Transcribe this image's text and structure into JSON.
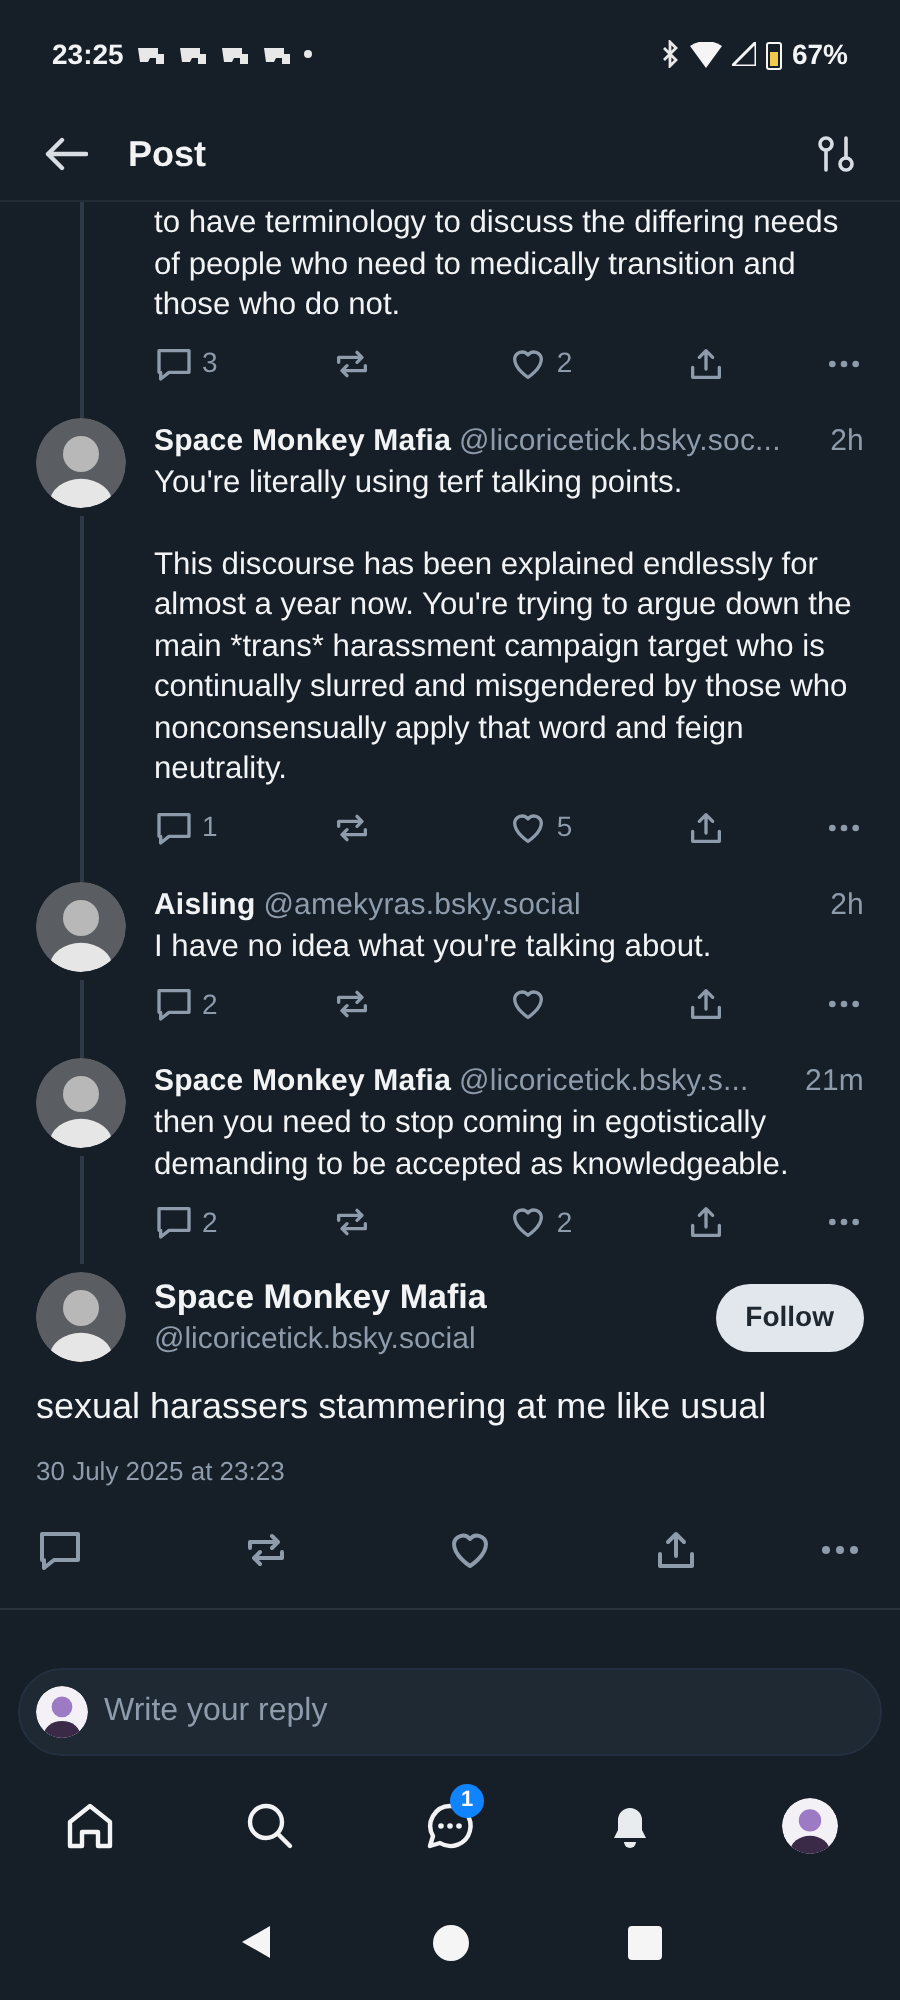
{
  "status_bar": {
    "time": "23:25",
    "battery": "67%"
  },
  "header": {
    "title": "Post"
  },
  "replies": [
    {
      "kind": "partial",
      "text": "to have terminology to discuss the differing needs of people who need to medically transition and those who do not.",
      "reply_count": "3",
      "like_count": "2"
    },
    {
      "kind": "full",
      "name": "Space Monkey Mafia",
      "handle": "@licoricetick.bsky.soc...",
      "time": "2h",
      "text": "You're literally using terf talking points.\n\nThis discourse has been explained endlessly for almost a year now. You're trying to argue down the main *trans* harassment campaign target who is continually slurred and misgendered by those who nonconsensually apply that word and feign neutrality.",
      "reply_count": "1",
      "like_count": "5"
    },
    {
      "kind": "full",
      "name": "Aisling",
      "handle": "@amekyras.bsky.social",
      "time": "2h",
      "text": "I have no idea what you're talking about.",
      "reply_count": "2"
    },
    {
      "kind": "full",
      "name": "Space Monkey Mafia",
      "handle": "@licoricetick.bsky.s...",
      "time": "21m",
      "text": "then you need to stop coming in egotistically demanding to be accepted as knowledgeable.",
      "reply_count": "2",
      "like_count": "2"
    }
  ],
  "main_post": {
    "name": "Space Monkey Mafia",
    "handle": "@licoricetick.bsky.social",
    "follow_label": "Follow",
    "text": "sexual harassers stammering at me like usual",
    "date": "30 July 2025 at 23:23"
  },
  "reply_field": {
    "placeholder": "Write your reply"
  },
  "nav": [
    {
      "kind": "home"
    },
    {
      "kind": "search"
    },
    {
      "kind": "chat",
      "badge": "1"
    },
    {
      "kind": "bell"
    },
    {
      "kind": "profile"
    }
  ]
}
